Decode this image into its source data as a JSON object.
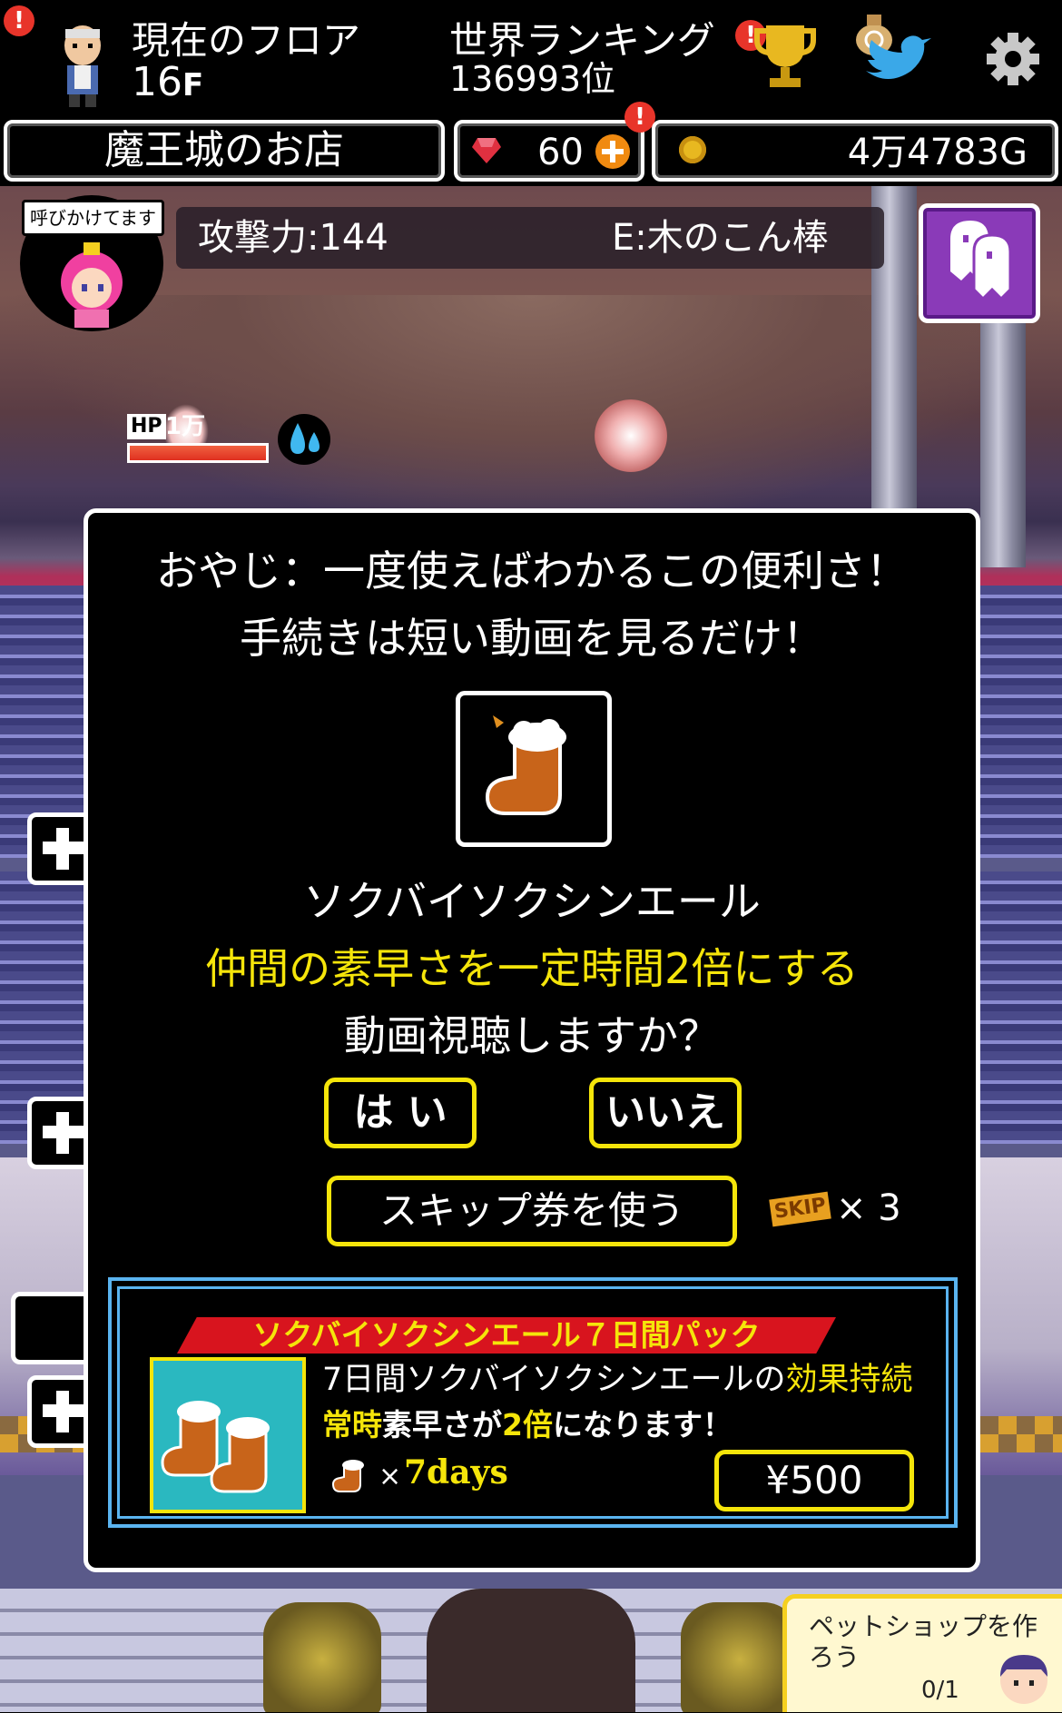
{
  "header": {
    "floor_label": "現在のフロア",
    "floor_value": "16",
    "floor_unit": "F",
    "ranking_label": "世界ランキング",
    "ranking_value": "136993位",
    "badge_mark": "!"
  },
  "status": {
    "shop_name": "魔王城のお店",
    "gems": "60",
    "gold": "4万4783G"
  },
  "character": {
    "speech": "呼びかけてます",
    "attack": "攻撃力:144",
    "equip": "E:木のこん棒",
    "hp_label": "HP",
    "hp_value": "1万"
  },
  "dialog": {
    "line1": "おやじ：一度使えばわかるこの便利さ！",
    "line2": "手続きは短い動画を見るだけ！",
    "item_name": "ソクバイソクシンエール",
    "item_effect": "仲間の素早さを一定時間2倍にする",
    "question": "動画視聴しますか？",
    "yes_label": "は い",
    "no_label": "いいえ",
    "skip_label": "スキップ券を使う",
    "skip_icon_text": "SKIP",
    "skip_count": "× 3"
  },
  "pack": {
    "title": "ソクバイソクシンエール７日間パック",
    "desc1_a": "7日間ソクバイソクシンエールの",
    "desc1_b": "効果持続",
    "desc2_a": "常時",
    "desc2_b": "素早さが",
    "desc2_c": "2倍",
    "desc2_d": "になります！",
    "qty_x": "×",
    "qty_days": "7days",
    "price": "¥500"
  },
  "quest": {
    "text": "ペットショップを作ろう",
    "progress": "0/1"
  },
  "colors": {
    "accent_yellow": "#f5e50a",
    "pack_border": "#5ab4f0",
    "banner_red": "#d8141e",
    "item_bg": "#2ab8c0"
  },
  "icons": [
    "trophy-icon",
    "twitter-bird-icon",
    "money-bag-icon",
    "gear-icon",
    "gem-icon",
    "coin-icon",
    "plus-icon",
    "ghost-icon",
    "water-drop-icon",
    "beer-boot-icon"
  ]
}
